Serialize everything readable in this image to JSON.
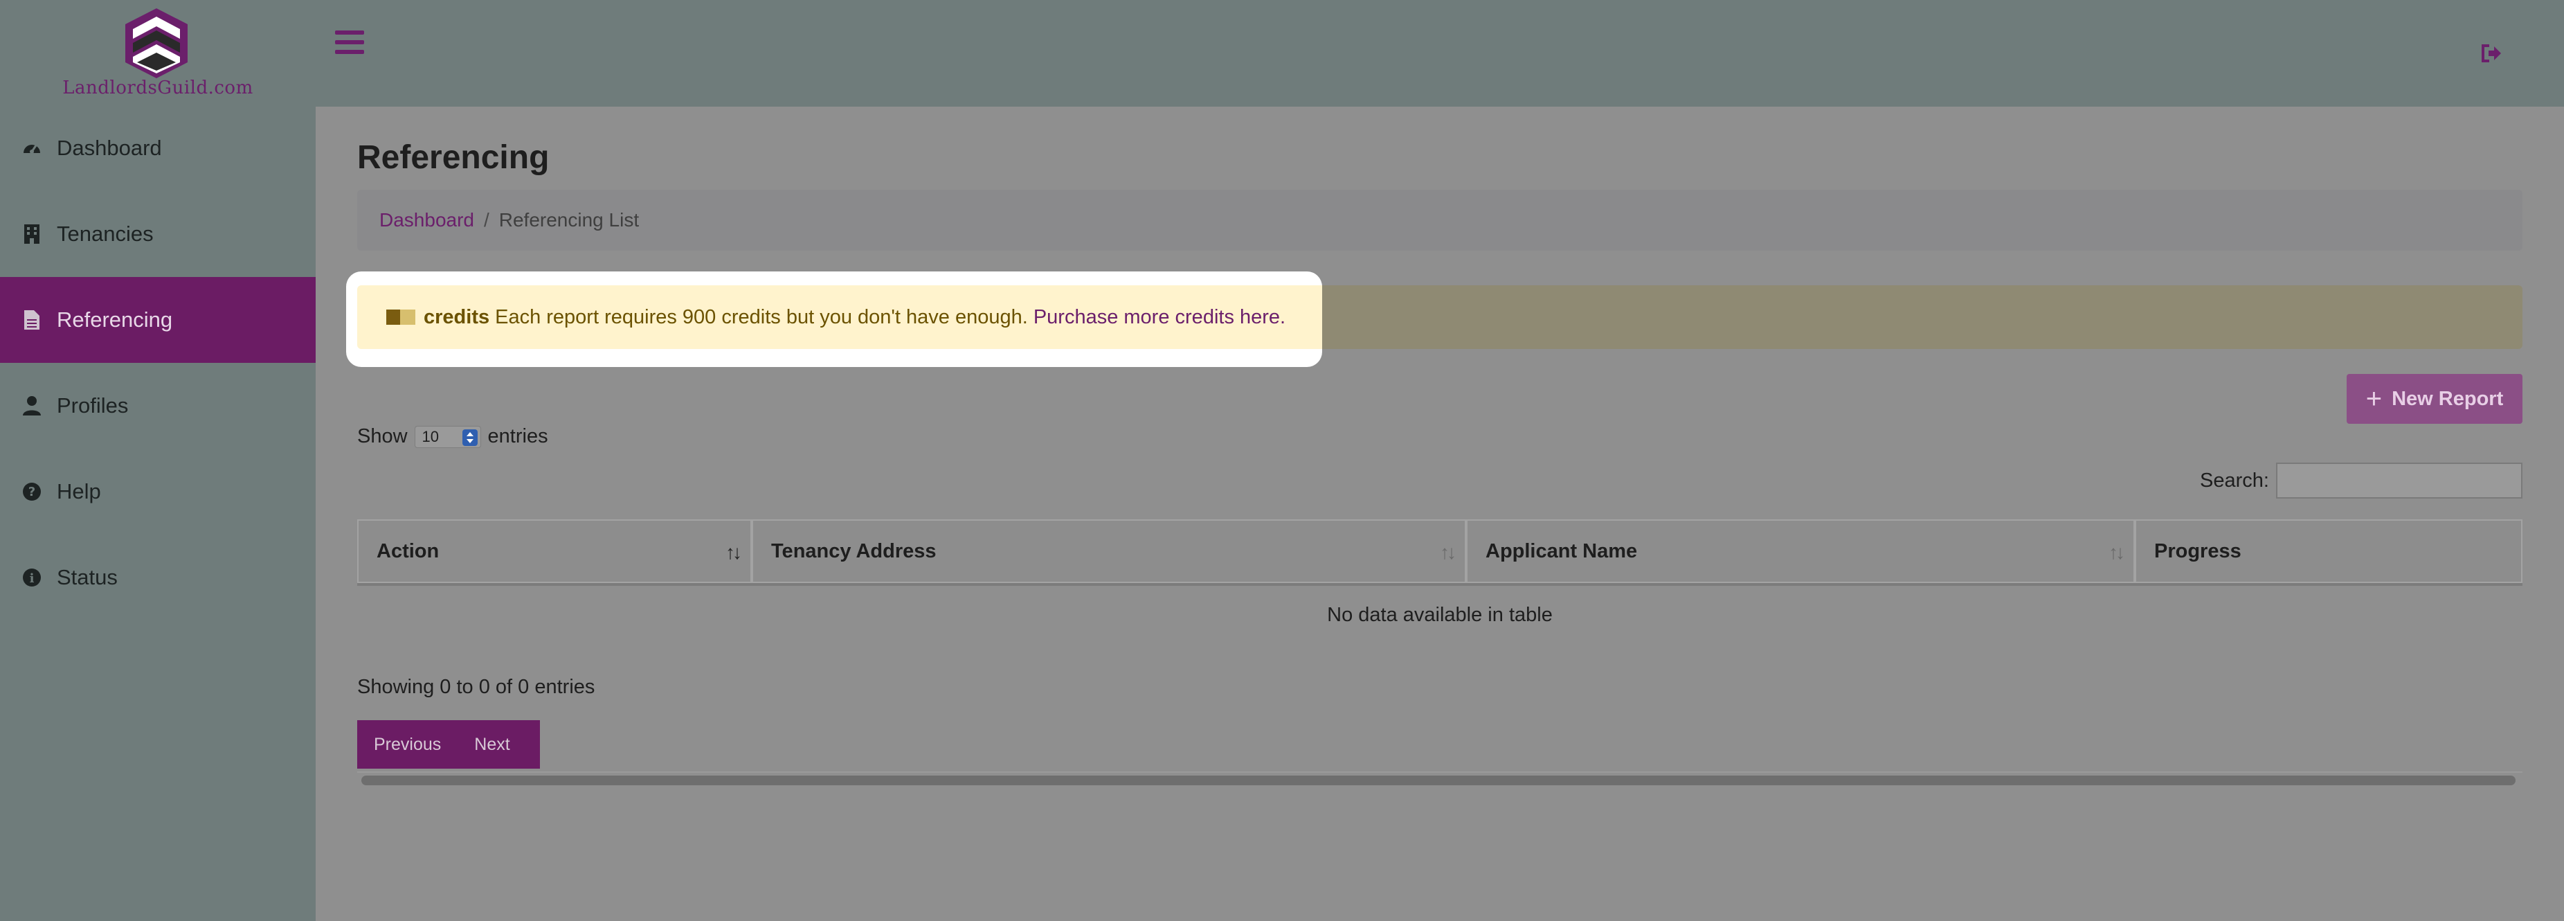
{
  "brand": {
    "name": "LandlordsGuild.com",
    "color": "#6b1f6b"
  },
  "sidebar": {
    "items": [
      {
        "label": "Dashboard",
        "icon": "tachometer-icon",
        "active": false
      },
      {
        "label": "Tenancies",
        "icon": "building-icon",
        "active": false
      },
      {
        "label": "Referencing",
        "icon": "file-icon",
        "active": true
      },
      {
        "label": "Profiles",
        "icon": "user-icon",
        "active": false
      },
      {
        "label": "Help",
        "icon": "question-circle-icon",
        "active": false
      },
      {
        "label": "Status",
        "icon": "info-circle-icon",
        "active": false
      }
    ]
  },
  "topbar": {
    "menu_icon": "hamburger-icon",
    "logout_icon": "sign-out-icon"
  },
  "page": {
    "title": "Referencing"
  },
  "breadcrumb": {
    "home": "Dashboard",
    "separator": "/",
    "current": "Referencing List"
  },
  "alert": {
    "icon": "credits-icon",
    "bold": "credits",
    "message": "Each report requires 900 credits but you don't have enough.",
    "link": "Purchase more credits here."
  },
  "actions": {
    "new_report": "New Report",
    "new_report_icon": "plus-icon"
  },
  "table_controls": {
    "show_label": "Show",
    "show_value": "10",
    "entries_label": "entries",
    "search_label": "Search:",
    "search_value": ""
  },
  "table": {
    "columns": [
      "Action",
      "Tenancy Address",
      "Applicant Name",
      "Progress"
    ],
    "rows": [],
    "empty_message": "No data available in table",
    "info": "Showing 0 to 0 of 0 entries"
  },
  "pagination": {
    "previous": "Previous",
    "next": "Next"
  }
}
